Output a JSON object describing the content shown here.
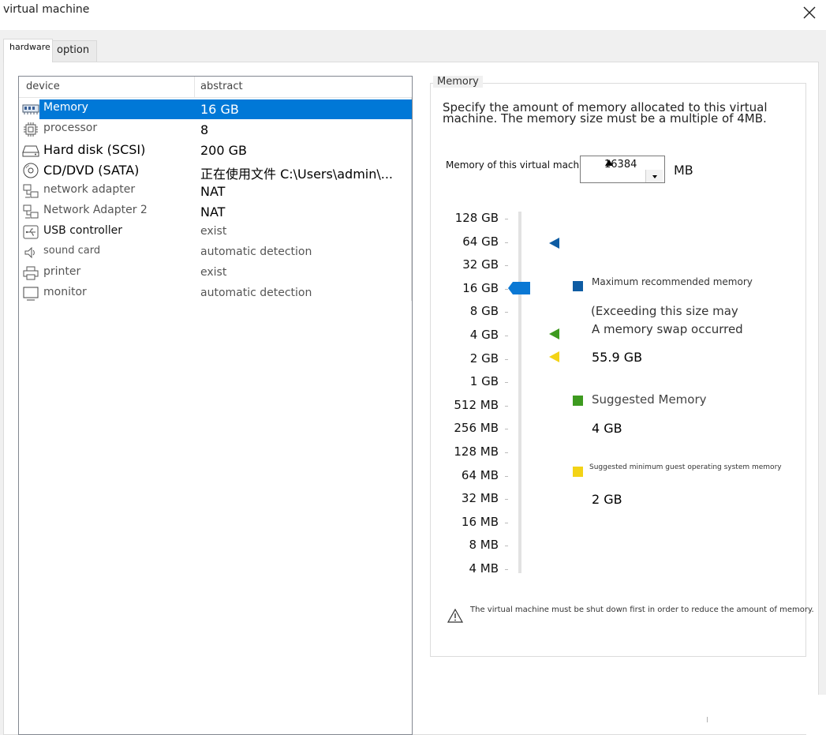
{
  "window": {
    "title": "virtual machine"
  },
  "tabs": [
    {
      "label": "hardware",
      "selected": true
    },
    {
      "label": "option",
      "selected": false
    }
  ],
  "device_list": {
    "columns": [
      "device",
      "abstract"
    ],
    "rows": [
      {
        "device": "Memory",
        "abstract": "16 GB",
        "icon": "memory-icon",
        "selected": true
      },
      {
        "device": "processor",
        "abstract": "8",
        "icon": "processor-icon"
      },
      {
        "device": "Hard disk (SCSI)",
        "abstract": "200 GB",
        "icon": "hard-disk-icon"
      },
      {
        "device": "CD/DVD (SATA)",
        "abstract": "正在使用文件 C:\\Users\\admin\\...",
        "icon": "cd-dvd-icon"
      },
      {
        "device": "network adapter",
        "abstract": "NAT",
        "icon": "network-adapter-icon"
      },
      {
        "device": "Network Adapter 2",
        "abstract": "NAT",
        "icon": "network-adapter-icon"
      },
      {
        "device": "USB controller",
        "abstract": "exist",
        "icon": "usb-icon"
      },
      {
        "device": "sound card",
        "abstract": "automatic detection",
        "icon": "speaker-icon"
      },
      {
        "device": "printer",
        "abstract": "exist",
        "icon": "printer-icon"
      },
      {
        "device": "monitor",
        "abstract": "automatic detection",
        "icon": "monitor-icon"
      }
    ]
  },
  "memory_panel": {
    "group_title": "Memory",
    "description": "Specify the amount of memory allocated to this virtual machine. The memory size must be a multiple of 4MB.",
    "field_label": "Memory of this virtual machine:",
    "field_value": "16384",
    "unit": "MB",
    "scale_labels": [
      "128 GB",
      "64 GB",
      "32 GB",
      "16 GB",
      "8 GB",
      "4 GB",
      "2 GB",
      "1 GB",
      "512 MB",
      "256 MB",
      "128 MB",
      "64 MB",
      "32 MB",
      "16 MB",
      "8 MB",
      "4 MB"
    ],
    "slider_value_label": "16 GB",
    "markers": {
      "max_recommended_level": "64 GB",
      "suggested_level": "4 GB",
      "guest_min_level": "2 GB"
    },
    "legend": {
      "max_recommended": {
        "label": "Maximum recommended memory",
        "note_line1": "(Exceeding this size may",
        "note_line2": "A memory swap occurred",
        "value": "55.9 GB",
        "color": "#0e5ca3"
      },
      "suggested": {
        "label": "Suggested Memory",
        "value": "4 GB",
        "color": "#3d9a1f"
      },
      "guest_min": {
        "label": "Suggested minimum guest operating system memory",
        "value": "2 GB",
        "color": "#f3d316"
      }
    },
    "warning": "The virtual machine must be shut down first in order to reduce the amount of memory."
  },
  "colors": {
    "selection": "#0078d7",
    "slider_thumb": "#0a78d4"
  }
}
